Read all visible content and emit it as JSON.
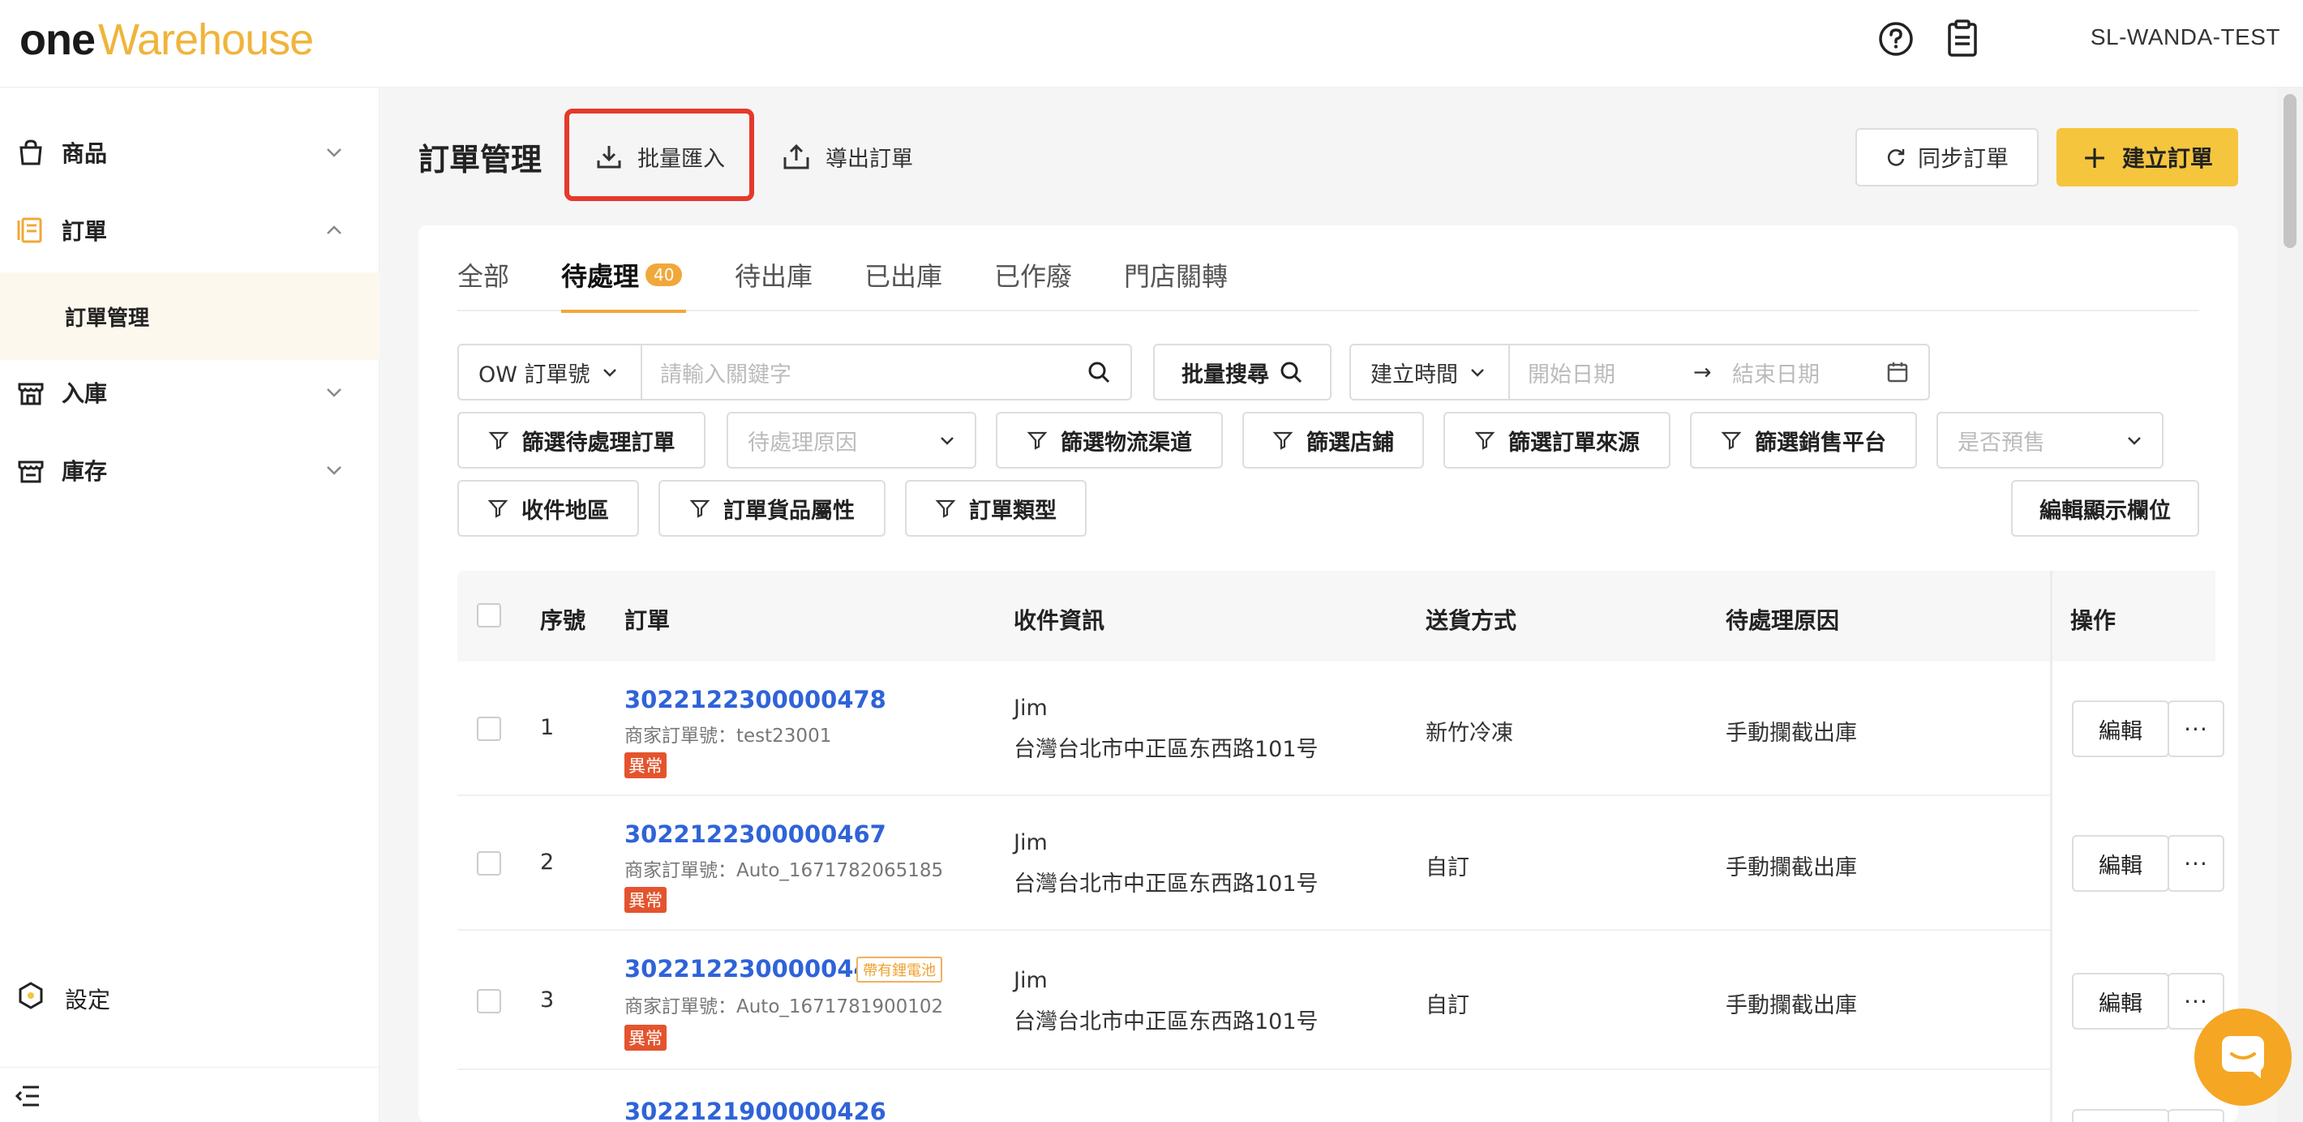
{
  "header": {
    "logo_one": "one",
    "logo_warehouse": "Warehouse",
    "user": "SL-WANDA-TEST"
  },
  "sidebar": {
    "items": [
      {
        "label": "商品"
      },
      {
        "label": "訂單"
      },
      {
        "label": "入庫"
      },
      {
        "label": "庫存"
      }
    ],
    "sub_active": "訂單管理",
    "settings": "設定"
  },
  "page": {
    "title": "訂單管理",
    "import_label": "批量匯入",
    "export_label": "導出訂單",
    "sync_label": "同步訂單",
    "create_label": "建立訂單"
  },
  "tabs": [
    {
      "label": "全部"
    },
    {
      "label": "待處理",
      "badge": "40"
    },
    {
      "label": "待出庫"
    },
    {
      "label": "已出庫"
    },
    {
      "label": "已作廢"
    },
    {
      "label": "門店關轉"
    }
  ],
  "filters": {
    "order_type_select": "OW 訂單號",
    "keyword_placeholder": "請輸入關鍵字",
    "batch_search": "批量搜尋",
    "time_select": "建立時間",
    "start_date_placeholder": "開始日期",
    "end_date_placeholder": "結束日期",
    "pending_filter": "篩選待處理訂單",
    "reason_placeholder": "待處理原因",
    "logistics_filter": "篩選物流渠道",
    "store_filter": "篩選店鋪",
    "source_filter": "篩選訂單來源",
    "platform_filter": "篩選銷售平台",
    "presale_placeholder": "是否預售",
    "region_filter": "收件地區",
    "goods_filter": "訂單貨品屬性",
    "ordertype_filter": "訂單類型",
    "edit_columns": "編輯顯示欄位"
  },
  "table": {
    "headers": {
      "seq": "序號",
      "order": "訂單",
      "recipient": "收件資訊",
      "delivery": "送貨方式",
      "reason": "待處理原因",
      "ops": "操作"
    },
    "rows": [
      {
        "seq": "1",
        "order_no": "3022122300000478",
        "merchant": "商家訂單號：test23001",
        "tag": "異常",
        "name": "Jim",
        "address": "台灣台北市中正區东西路101号",
        "delivery": "新竹冷凍",
        "reason": "手動攔截出庫",
        "edit": "編輯",
        "more": "···"
      },
      {
        "seq": "2",
        "order_no": "3022122300000467",
        "merchant": "商家訂單號：Auto_1671782065185",
        "tag": "異常",
        "name": "Jim",
        "address": "台灣台北市中正區东西路101号",
        "delivery": "自訂",
        "reason": "手動攔截出庫",
        "edit": "編輯",
        "more": "···"
      },
      {
        "seq": "3",
        "order_no": "3022122300000445",
        "battery": "帶有鋰電池",
        "merchant": "商家訂單號：Auto_1671781900102",
        "tag": "異常",
        "name": "Jim",
        "address": "台灣台北市中正區东西路101号",
        "delivery": "自訂",
        "reason": "手動攔截出庫",
        "edit": "編輯",
        "more": "···"
      },
      {
        "order_no": "3022121900000426"
      }
    ]
  },
  "colors": {
    "accent": "#f5c53d",
    "link": "#2f63d8",
    "danger": "#e3542e",
    "highlight": "#e5392b"
  }
}
